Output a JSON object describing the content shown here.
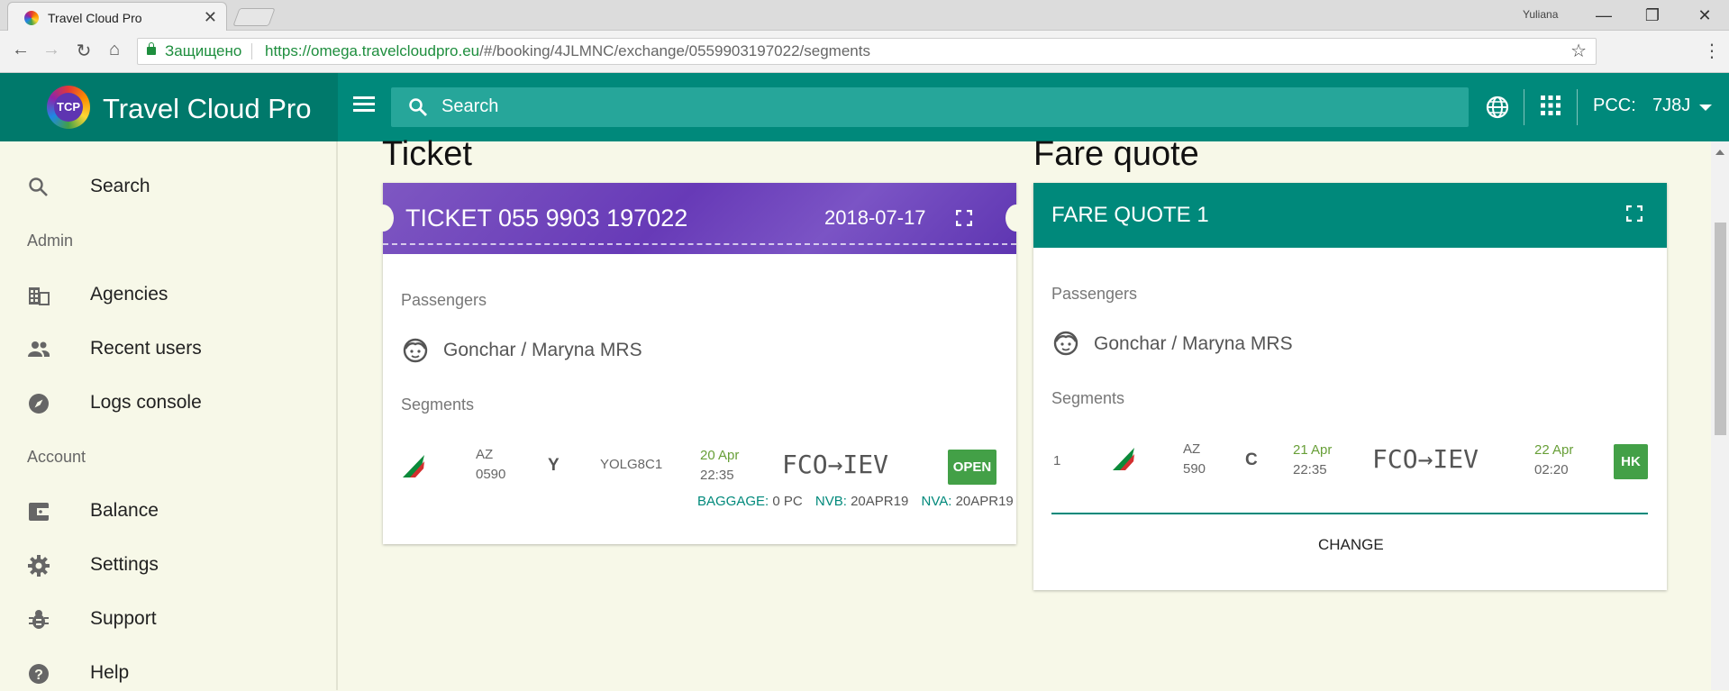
{
  "browser": {
    "tab_title": "Travel Cloud Pro",
    "user": "Yuliana",
    "secure_label": "Защищено",
    "url_host": "https://omega.travelcloudpro.eu",
    "url_path": "/#/booking/4JLMNC/exchange/0559903197022/segments"
  },
  "header": {
    "brand": "Travel Cloud Pro",
    "logo_text": "TCP",
    "search_placeholder": "Search",
    "pcc_label": "PCC:",
    "pcc_value": "7J8J"
  },
  "sidebar": {
    "search": "Search",
    "admin_section": "Admin",
    "agencies": "Agencies",
    "recent_users": "Recent users",
    "logs_console": "Logs console",
    "account_section": "Account",
    "balance": "Balance",
    "settings": "Settings",
    "support": "Support",
    "help": "Help"
  },
  "ticket": {
    "section_title": "Ticket",
    "title": "TICKET  055 9903 197022",
    "date": "2018-07-17",
    "passengers_label": "Passengers",
    "passenger": "Gonchar / Maryna MRS",
    "segments_label": "Segments",
    "segment": {
      "airline": "AZ",
      "flight": "0590",
      "class": "Y",
      "fare_basis": "YOLG8C1",
      "dep_date": "20 Apr",
      "dep_time": "22:35",
      "route": "FCO→IEV",
      "status": "OPEN"
    },
    "baggage_key": "BAGGAGE:",
    "baggage_val": "0 PC",
    "nvb_key": "NVB:",
    "nvb_val": "20APR19",
    "nva_key": "NVA:",
    "nva_val": "20APR19"
  },
  "fare_quote": {
    "section_title": "Fare quote",
    "title": "FARE QUOTE 1",
    "passengers_label": "Passengers",
    "passenger": "Gonchar / Maryna MRS",
    "segments_label": "Segments",
    "segment": {
      "index": "1",
      "airline": "AZ",
      "flight": "590",
      "class": "C",
      "dep_date": "21 Apr",
      "dep_time": "22:35",
      "route": "FCO→IEV",
      "arr_date": "22 Apr",
      "arr_time": "02:20",
      "status": "HK"
    },
    "change_label": "CHANGE"
  },
  "colors": {
    "brand_teal": "#00897b",
    "ticket_purple": "#673ab7",
    "status_green": "#43a047"
  }
}
